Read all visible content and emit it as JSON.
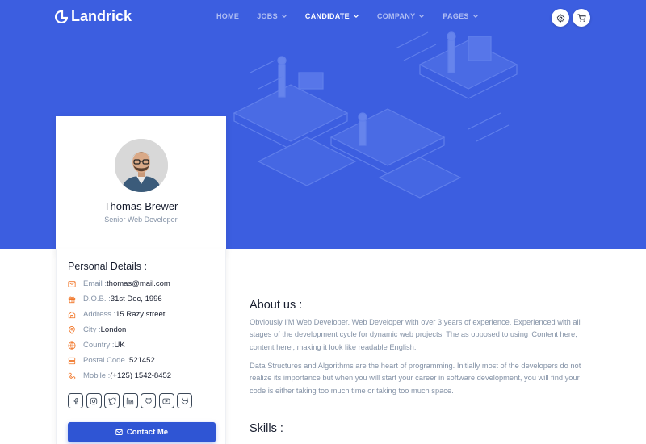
{
  "brand": {
    "name": "Landrick",
    "logo_icon": "landrick-logo-icon"
  },
  "nav": {
    "items": [
      {
        "label": "HOME",
        "has_dropdown": false,
        "active": false
      },
      {
        "label": "JOBS",
        "has_dropdown": true,
        "active": false
      },
      {
        "label": "CANDIDATE",
        "has_dropdown": true,
        "active": true
      },
      {
        "label": "COMPANY",
        "has_dropdown": true,
        "active": false
      },
      {
        "label": "PAGES",
        "has_dropdown": true,
        "active": false
      }
    ],
    "buttons": [
      {
        "icon": "gear-icon"
      },
      {
        "icon": "cart-icon"
      }
    ]
  },
  "profile": {
    "name": "Thomas Brewer",
    "role": "Senior Web Developer"
  },
  "details": {
    "title": "Personal Details :",
    "rows": [
      {
        "icon": "mail-icon",
        "label": "Email : ",
        "value": "thomas@mail.com"
      },
      {
        "icon": "gift-icon",
        "label": "D.O.B. : ",
        "value": "31st Dec, 1996"
      },
      {
        "icon": "home-icon",
        "label": "Address : ",
        "value": "15 Razy street"
      },
      {
        "icon": "map-pin-icon",
        "label": "City : ",
        "value": "London"
      },
      {
        "icon": "globe-icon",
        "label": "Country : ",
        "value": "UK"
      },
      {
        "icon": "server-icon",
        "label": "Postal Code : ",
        "value": "521452"
      },
      {
        "icon": "phone-icon",
        "label": "Mobile : ",
        "value": "(+125) 1542-8452"
      }
    ],
    "socials": [
      "facebook-icon",
      "instagram-icon",
      "twitter-icon",
      "linkedin-icon",
      "github-icon",
      "youtube-icon",
      "gitlab-icon"
    ],
    "contact_label": "Contact Me"
  },
  "about": {
    "title": "About us :",
    "paragraphs": [
      "Obviously I'M Web Developer. Web Developer with over 3 years of experience. Experienced with all stages of the development cycle for dynamic web projects. The as opposed to using 'Content here, content here', making it look like readable English.",
      "Data Structures and Algorithms are the heart of programming. Initially most of the developers do not realize its importance but when you will start your career in software development, you will find your code is either taking too much time or taking too much space."
    ]
  },
  "skills": {
    "title": "Skills :"
  },
  "colors": {
    "hero": "#3c5ee0",
    "primary": "#2f55d4",
    "icon_accent": "#f17425",
    "muted": "#8492a6",
    "dark": "#161c2d"
  }
}
